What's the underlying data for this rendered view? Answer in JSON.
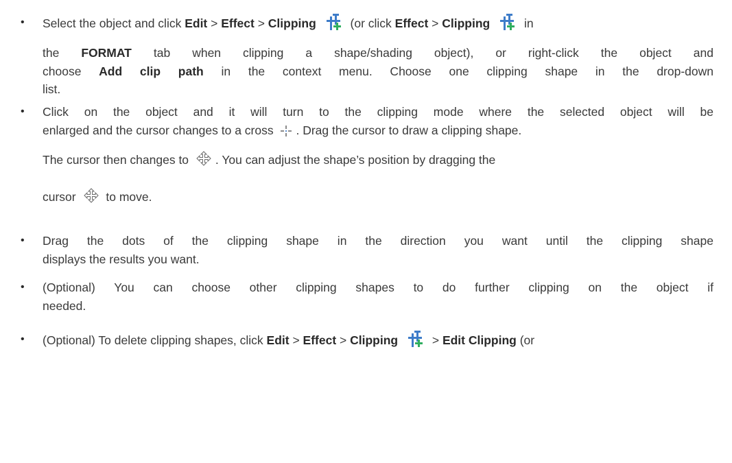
{
  "bullets": [
    {
      "symbol": "•",
      "lines": [
        {
          "s1": "Select the object and click ",
          "b1": "Edit",
          "s2": " > ",
          "b2": "Effect",
          "s3": " > ",
          "b3": "Clipping",
          "s4": "(or click ",
          "b4": "Effect",
          "s5": " > ",
          "b5": "Clipping",
          "s6": "in"
        },
        {
          "s1": "the ",
          "b1": "FORMAT",
          "s2": " tab when clipping a shape/shading object), or right-click the object and"
        },
        {
          "s1": "choose ",
          "b1": "Add clip path",
          "s2": " in the context menu. Choose one clipping shape in the drop-down"
        },
        {
          "s1": "list."
        }
      ]
    },
    {
      "symbol": "•",
      "lines": [
        {
          "s1": "Click on the object and it will turn to the clipping mode where the selected object will be"
        },
        {
          "s1": "enlarged and the cursor changes to a cross",
          "s2": ". Drag the cursor to draw a clipping shape."
        },
        {
          "s1": "The cursor then changes to",
          "s2": ". You can adjust the shape’s position by dragging the"
        },
        {
          "s1": "cursor",
          "s2": "to move."
        }
      ]
    },
    {
      "symbol": "•",
      "lines": [
        {
          "s1": "Drag the dots of the clipping shape in the direction you want until the clipping shape"
        },
        {
          "s1": "displays the results you want."
        }
      ]
    },
    {
      "symbol": "•",
      "lines": [
        {
          "s1": "(Optional) You can choose other clipping shapes to do further clipping on the object if"
        },
        {
          "s1": "needed."
        }
      ]
    },
    {
      "symbol": "•",
      "lines": [
        {
          "s1": "(Optional) To delete clipping shapes, click ",
          "b1": "Edit",
          "s2": " > ",
          "b2": "Effect",
          "s3": " > ",
          "b3": "Clipping",
          "s4": " > ",
          "b4": "Edit Clipping",
          "s5": " (or"
        }
      ]
    }
  ],
  "icons": {
    "clipping": "clipping-icon",
    "cross_cursor": "cross-cursor-icon",
    "move_cursor": "move-cursor-icon"
  },
  "colors": {
    "clip_icon_blue": "#3d7cc9",
    "clip_icon_green": "#2fae5f",
    "text": "#3a3a3a"
  }
}
